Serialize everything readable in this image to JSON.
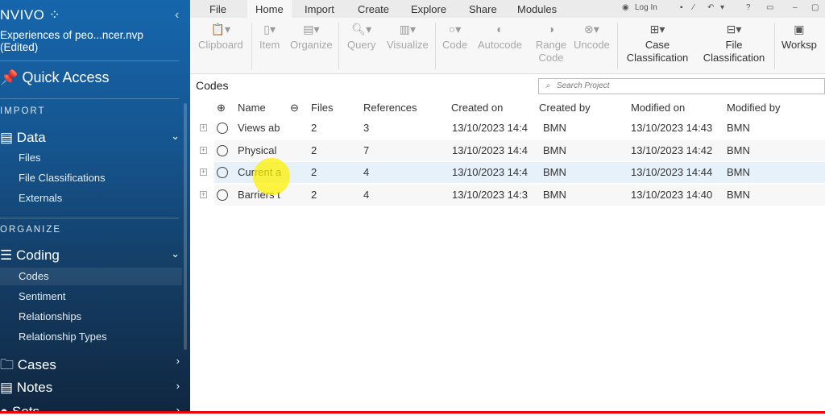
{
  "app": {
    "logo": "NVIVO",
    "project": "Experiences of peo...ncer.nvp",
    "project_state": "(Edited)"
  },
  "sidebar": {
    "quick_access": "Quick Access",
    "sections": [
      {
        "label": "IMPORT"
      },
      {
        "label": "ORGANIZE"
      }
    ],
    "data": {
      "label": "Data",
      "items": [
        "Files",
        "File Classifications",
        "Externals"
      ]
    },
    "coding": {
      "label": "Coding",
      "items": [
        "Codes",
        "Sentiment",
        "Relationships",
        "Relationship Types"
      ],
      "selected": "Codes"
    },
    "cases": "Cases",
    "notes": "Notes",
    "sets": "Sets"
  },
  "menu_tabs": [
    "File",
    "Home",
    "Import",
    "Create",
    "Explore",
    "Share",
    "Modules"
  ],
  "active_tab": "Home",
  "titlebar": {
    "login": "Log In",
    "help": "?"
  },
  "ribbon": [
    {
      "label": "Clipboard"
    },
    {
      "label": "Item"
    },
    {
      "label": "Organize"
    },
    {
      "label": "Query"
    },
    {
      "label": "Visualize"
    },
    {
      "label": "Code"
    },
    {
      "label": "Autocode"
    },
    {
      "label": "Range Code"
    },
    {
      "label": "Uncode"
    },
    {
      "label": "Case Classification"
    },
    {
      "label": "File Classification"
    },
    {
      "label": "Worksp"
    }
  ],
  "codes": {
    "title": "Codes",
    "search_placeholder": "Search Project",
    "columns": [
      "Name",
      "Files",
      "References",
      "Created on",
      "Created by",
      "Modified on",
      "Modified by"
    ],
    "rows": [
      {
        "name": "Views ab",
        "files": "2",
        "refs": "3",
        "created": "13/10/2023 14:4",
        "by": "BMN",
        "modified": "13/10/2023 14:43",
        "mby": "BMN"
      },
      {
        "name": "Physical",
        "files": "2",
        "refs": "7",
        "created": "13/10/2023 14:4",
        "by": "BMN",
        "modified": "13/10/2023 14:42",
        "mby": "BMN"
      },
      {
        "name": "Current a",
        "files": "2",
        "refs": "4",
        "created": "13/10/2023 14:4",
        "by": "BMN",
        "modified": "13/10/2023 14:44",
        "mby": "BMN"
      },
      {
        "name": "Barriers t",
        "files": "2",
        "refs": "4",
        "created": "13/10/2023 14:3",
        "by": "BMN",
        "modified": "13/10/2023 14:40",
        "mby": "BMN"
      }
    ]
  }
}
